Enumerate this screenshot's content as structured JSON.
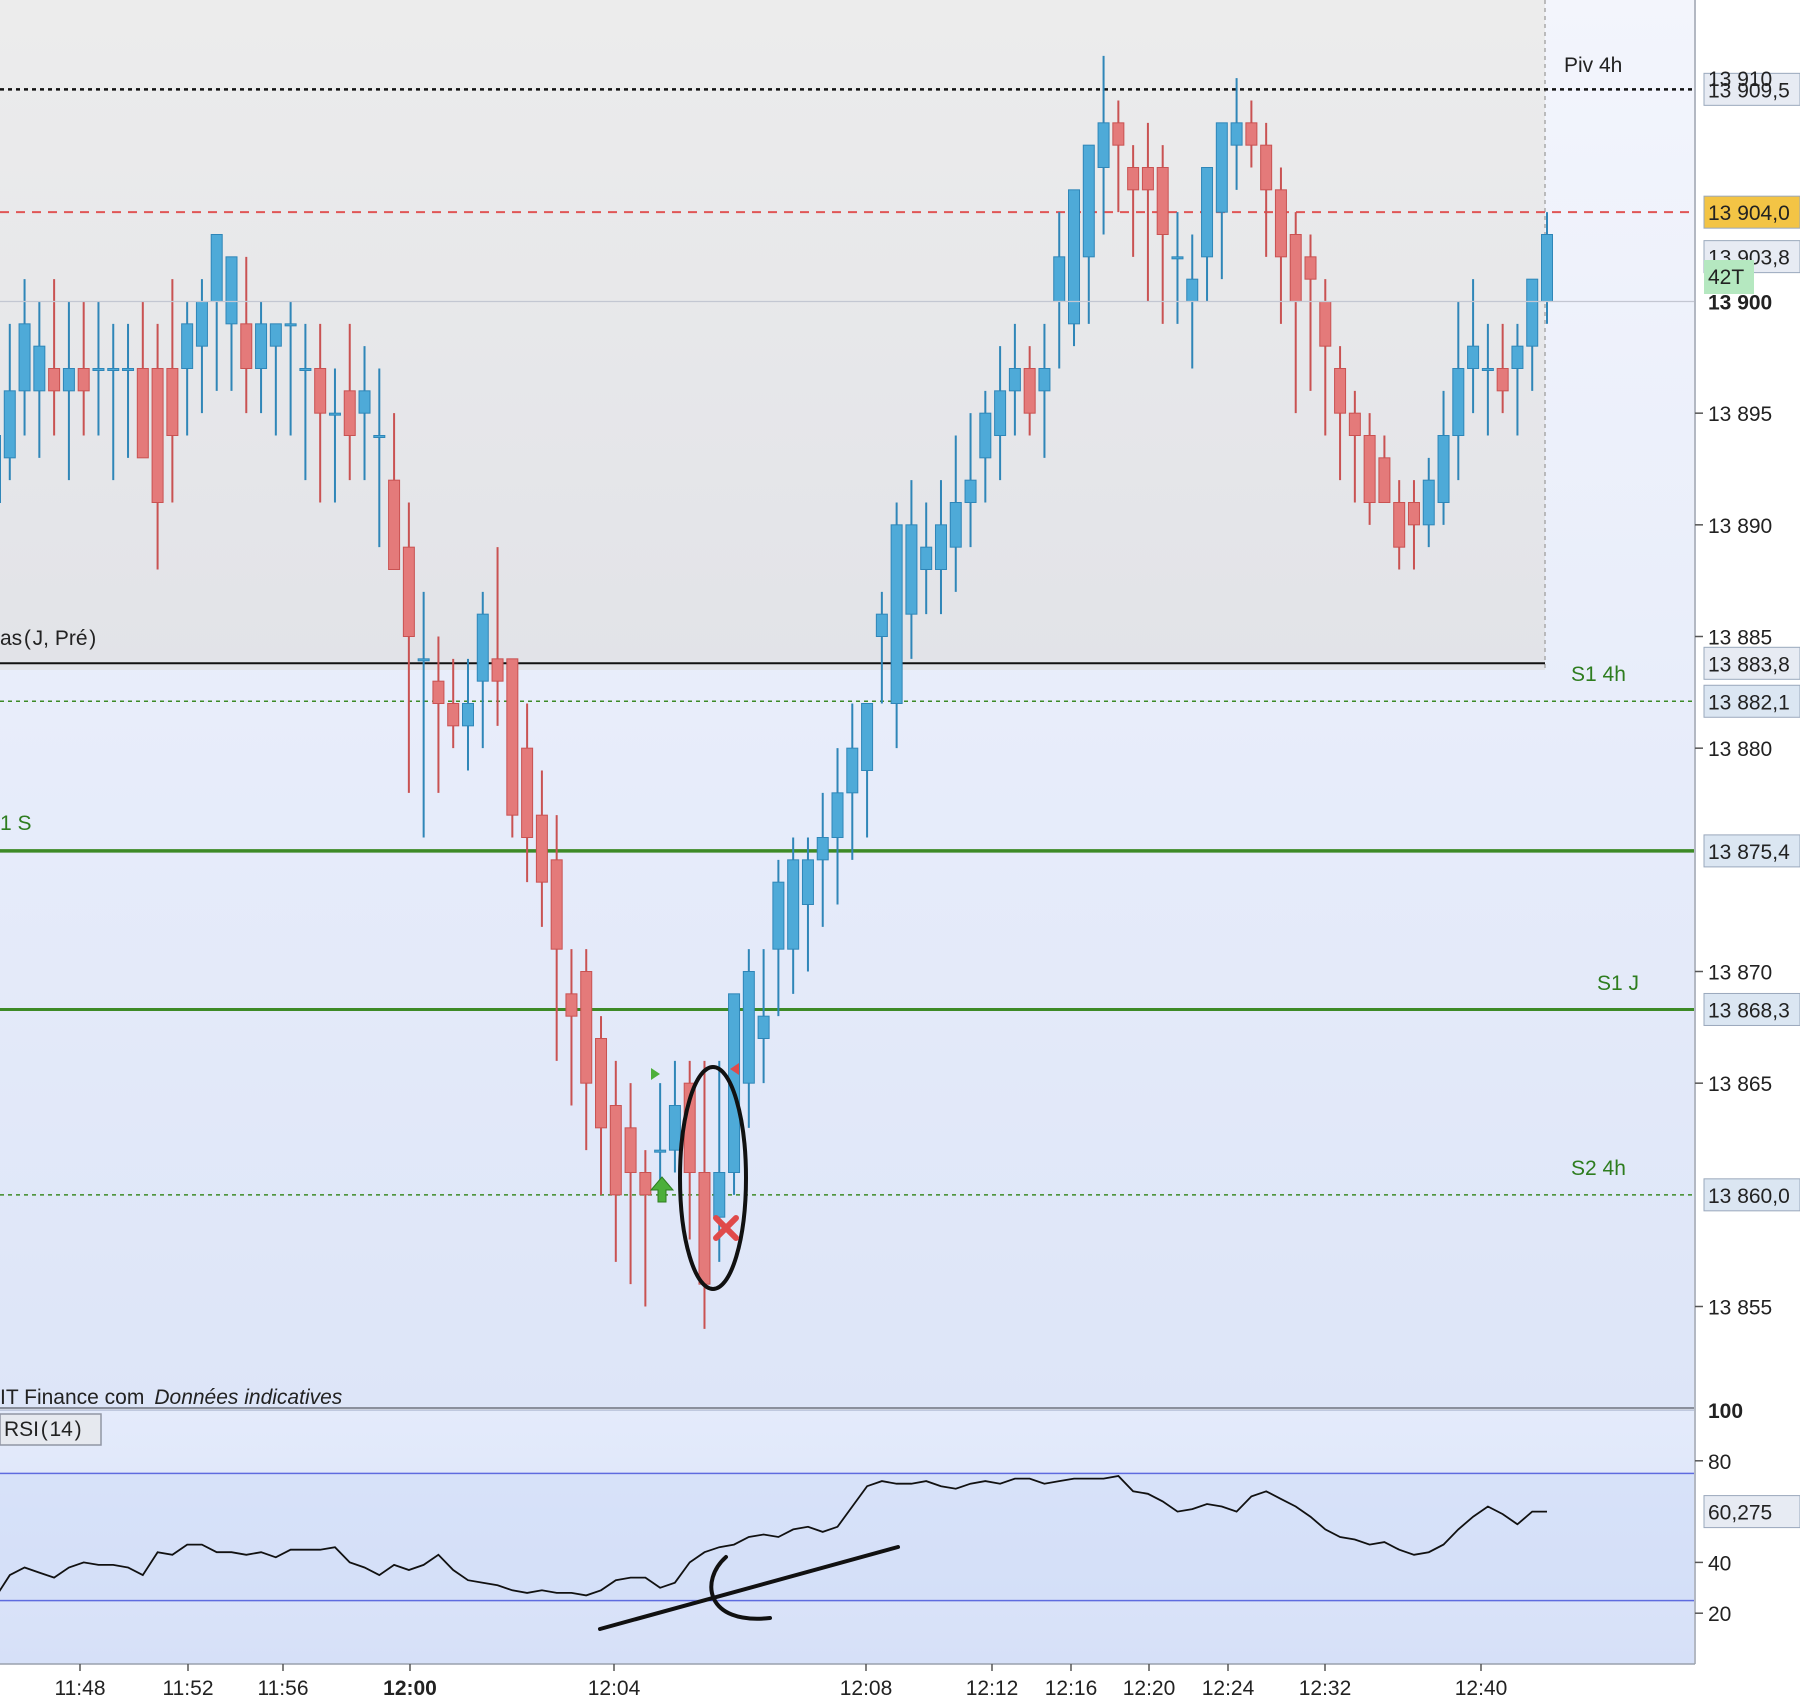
{
  "chart_data": {
    "type": "candlestick",
    "ylim": [
      13850.5,
      13913.5
    ],
    "y_ticks": [
      13855,
      13865,
      13870,
      13880,
      13885,
      13890,
      13895
    ],
    "y_tick_labels": [
      "13 855",
      "13 865",
      "13 870",
      "13 880",
      "13 885",
      "13 890",
      "13 895"
    ],
    "y_tick_partial": "13 910",
    "y_tick_bold": {
      "value": 13900,
      "label": "13 900"
    },
    "x_tick_labels": [
      "11:48",
      "11:52",
      "11:56",
      "12:00",
      "12:04",
      "12:08",
      "12:12",
      "12:16",
      "12:20",
      "12:24",
      "12:32",
      "12:40"
    ],
    "x_tick_bold": "12:00",
    "candles": [
      [
        13891,
        13896,
        13889,
        13894
      ],
      [
        13893,
        13899,
        13892,
        13896
      ],
      [
        13896,
        13901,
        13894,
        13899
      ],
      [
        13896,
        13900,
        13893,
        13898
      ],
      [
        13897,
        13901,
        13894,
        13896
      ],
      [
        13896,
        13900,
        13892,
        13897
      ],
      [
        13897,
        13900,
        13894,
        13896
      ],
      [
        13897,
        13900,
        13894,
        13897
      ],
      [
        13897,
        13899,
        13892,
        13897
      ],
      [
        13897,
        13899,
        13893,
        13897
      ],
      [
        13897,
        13900,
        13893,
        13893
      ],
      [
        13897,
        13899,
        13888,
        13891
      ],
      [
        13897,
        13901,
        13891,
        13894
      ],
      [
        13897,
        13900,
        13894,
        13899
      ],
      [
        13898,
        13901,
        13895,
        13900
      ],
      [
        13900,
        13901,
        13896,
        13903
      ],
      [
        13899,
        13901,
        13896,
        13902
      ],
      [
        13899,
        13902,
        13895,
        13897
      ],
      [
        13897,
        13900,
        13895,
        13899
      ],
      [
        13898,
        13899,
        13894,
        13899
      ],
      [
        13899,
        13900,
        13894,
        13899
      ],
      [
        13897,
        13899,
        13892,
        13897
      ],
      [
        13897,
        13899,
        13891,
        13895
      ],
      [
        13895,
        13897,
        13891,
        13895
      ],
      [
        13896,
        13899,
        13892,
        13894
      ],
      [
        13895,
        13898,
        13892,
        13896
      ],
      [
        13894,
        13897,
        13889,
        13894
      ],
      [
        13892,
        13895,
        13888,
        13888
      ],
      [
        13889,
        13891,
        13878,
        13885
      ],
      [
        13884,
        13887,
        13876,
        13884
      ],
      [
        13883,
        13885,
        13878,
        13882
      ],
      [
        13882,
        13884,
        13880,
        13881
      ],
      [
        13881,
        13884,
        13879,
        13882
      ],
      [
        13883,
        13887,
        13880,
        13886
      ],
      [
        13884,
        13889,
        13881,
        13883
      ],
      [
        13884,
        13884,
        13876,
        13877
      ],
      [
        13880,
        13882,
        13874,
        13876
      ],
      [
        13877,
        13879,
        13872,
        13874
      ],
      [
        13875,
        13877,
        13866,
        13871
      ],
      [
        13869,
        13871,
        13864,
        13868
      ],
      [
        13870,
        13871,
        13862,
        13865
      ],
      [
        13867,
        13868,
        13860,
        13863
      ],
      [
        13864,
        13866,
        13857,
        13860
      ],
      [
        13863,
        13865,
        13856,
        13861
      ],
      [
        13861,
        13862,
        13855,
        13860
      ],
      [
        13862,
        13865,
        13860,
        13862
      ],
      [
        13862,
        13866,
        13861,
        13864
      ],
      [
        13865,
        13866,
        13858,
        13861
      ],
      [
        13861,
        13866,
        13854,
        13856
      ],
      [
        13859,
        13866,
        13857,
        13861
      ],
      [
        13861,
        13868,
        13860,
        13869
      ],
      [
        13865,
        13871,
        13863,
        13870
      ],
      [
        13867,
        13871,
        13865,
        13868
      ],
      [
        13871,
        13875,
        13868,
        13874
      ],
      [
        13871,
        13876,
        13869,
        13875
      ],
      [
        13873,
        13876,
        13870,
        13875
      ],
      [
        13875,
        13878,
        13872,
        13876
      ],
      [
        13876,
        13880,
        13873,
        13878
      ],
      [
        13878,
        13882,
        13875,
        13880
      ],
      [
        13879,
        13882,
        13876,
        13882
      ],
      [
        13885,
        13887,
        13882,
        13886
      ],
      [
        13882,
        13891,
        13880,
        13890
      ],
      [
        13886,
        13892,
        13884,
        13890
      ],
      [
        13888,
        13891,
        13886,
        13889
      ],
      [
        13888,
        13892,
        13886,
        13890
      ],
      [
        13889,
        13894,
        13887,
        13891
      ],
      [
        13891,
        13895,
        13889,
        13892
      ],
      [
        13893,
        13896,
        13891,
        13895
      ],
      [
        13894,
        13898,
        13892,
        13896
      ],
      [
        13896,
        13899,
        13894,
        13897
      ],
      [
        13897,
        13898,
        13894,
        13895
      ],
      [
        13896,
        13899,
        13893,
        13897
      ],
      [
        13900,
        13904,
        13897,
        13902
      ],
      [
        13899,
        13903,
        13898,
        13905
      ],
      [
        13902,
        13906,
        13899,
        13907
      ],
      [
        13906,
        13911,
        13903,
        13908
      ],
      [
        13908,
        13909,
        13904,
        13907
      ],
      [
        13906,
        13907,
        13902,
        13905
      ],
      [
        13906,
        13908,
        13900,
        13905
      ],
      [
        13906,
        13907,
        13899,
        13903
      ],
      [
        13902,
        13904,
        13899,
        13902
      ],
      [
        13900,
        13903,
        13897,
        13901
      ],
      [
        13902,
        13905,
        13900,
        13906
      ],
      [
        13904,
        13908,
        13901,
        13908
      ],
      [
        13907,
        13910,
        13905,
        13908
      ],
      [
        13908,
        13909,
        13906,
        13907
      ],
      [
        13907,
        13908,
        13902,
        13905
      ],
      [
        13905,
        13906,
        13899,
        13902
      ],
      [
        13903,
        13904,
        13895,
        13900
      ],
      [
        13902,
        13903,
        13896,
        13901
      ],
      [
        13900,
        13901,
        13894,
        13898
      ],
      [
        13897,
        13898,
        13892,
        13895
      ],
      [
        13895,
        13896,
        13891,
        13894
      ],
      [
        13894,
        13895,
        13890,
        13891
      ],
      [
        13893,
        13894,
        13891,
        13891
      ],
      [
        13891,
        13892,
        13888,
        13889
      ],
      [
        13891,
        13892,
        13888,
        13890
      ],
      [
        13890,
        13893,
        13889,
        13892
      ],
      [
        13891,
        13896,
        13890,
        13894
      ],
      [
        13894,
        13900,
        13892,
        13897
      ],
      [
        13897,
        13901,
        13895,
        13898
      ],
      [
        13897,
        13899,
        13894,
        13897
      ],
      [
        13897,
        13899,
        13895,
        13896
      ],
      [
        13897,
        13899,
        13894,
        13898
      ],
      [
        13898,
        13901,
        13896,
        13901
      ],
      [
        13900,
        13904,
        13899,
        13903
      ]
    ],
    "levels": [
      {
        "value": 13909.5,
        "label": "13 909,5",
        "name": "Piv 4h"
      },
      {
        "value": 13904.0,
        "label": "13 904,0"
      },
      {
        "value": 13903.8,
        "label": "13 903,8"
      },
      {
        "value": 13883.8,
        "label": "13 883,8",
        "name": "as ( J, Pré )"
      },
      {
        "value": 13882.1,
        "label": "13 882,1",
        "name": "S1 4h"
      },
      {
        "value": 13875.4,
        "label": "13 875,4",
        "name": "1 S"
      },
      {
        "value": 13868.3,
        "label": "13 868,3",
        "name": "S1 J"
      },
      {
        "value": 13860.0,
        "label": "13 860,0",
        "name": "S2 4h"
      }
    ],
    "tick_count_label": "42T",
    "source_prefix": "IT  Finance  com",
    "source_note": "Données indicatives",
    "rsi": {
      "name": "RSI ( 14 )",
      "ylim": [
        0,
        100
      ],
      "ticks": [
        20,
        40,
        80
      ],
      "tick_max": "100",
      "bands": [
        25,
        75
      ],
      "last_label": "60,275",
      "values": [
        26,
        35,
        38,
        36,
        34,
        38,
        40,
        39,
        39,
        38,
        35,
        44,
        43,
        47,
        47,
        44,
        44,
        43,
        44,
        42,
        45,
        45,
        45,
        46,
        40,
        38,
        35,
        39,
        37,
        39,
        43,
        37,
        33,
        32,
        31,
        29,
        28,
        29,
        28,
        28,
        27,
        29,
        33,
        34,
        34,
        30,
        32,
        40,
        44,
        46,
        47,
        50,
        51,
        50,
        53,
        54,
        52,
        54,
        62,
        70,
        72,
        71,
        71,
        72,
        70,
        69,
        71,
        72,
        71,
        73,
        73,
        71,
        72,
        73,
        73,
        73,
        74,
        68,
        67,
        64,
        60,
        61,
        63,
        62,
        60,
        66,
        68,
        65,
        62,
        58,
        53,
        50,
        49,
        47,
        48,
        45,
        43,
        44,
        47,
        53,
        58,
        62,
        59,
        55,
        60,
        60
      ]
    }
  },
  "colors": {
    "up": "#4eaad8",
    "down": "#e47a7a",
    "level_green": "#3d8a26",
    "rsi_band": "#3340d6",
    "tick_box": "#b5e8c0",
    "last_price_box": "#f3c445"
  }
}
